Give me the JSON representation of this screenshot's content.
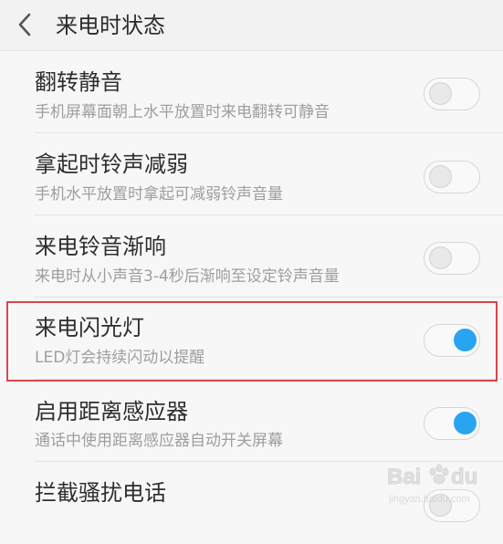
{
  "header": {
    "title": "来电时状态"
  },
  "settings": [
    {
      "title": "翻转静音",
      "subtitle": "手机屏幕面朝上水平放置时来电翻转可静音",
      "enabled": false
    },
    {
      "title": "拿起时铃声减弱",
      "subtitle": "手机水平放置时拿起可减弱铃声音量",
      "enabled": false
    },
    {
      "title": "来电铃音渐响",
      "subtitle": "来电时从小声音3-4秒后渐响至设定铃声音量",
      "enabled": false
    },
    {
      "title": "来电闪光灯",
      "subtitle": "LED灯会持续闪动以提醒",
      "enabled": true
    },
    {
      "title": "启用距离感应器",
      "subtitle": "通话中使用距离感应器自动开关屏幕",
      "enabled": true
    },
    {
      "title": "拦截骚扰电话",
      "subtitle": "",
      "enabled": false
    }
  ],
  "icons": {
    "back": "chevron-left-icon"
  },
  "colors": {
    "accent": "#29a4f1",
    "highlight": "#d9464a"
  },
  "watermark": {
    "brand": "Baidu经验",
    "url": "jingyan.baidu.com"
  }
}
